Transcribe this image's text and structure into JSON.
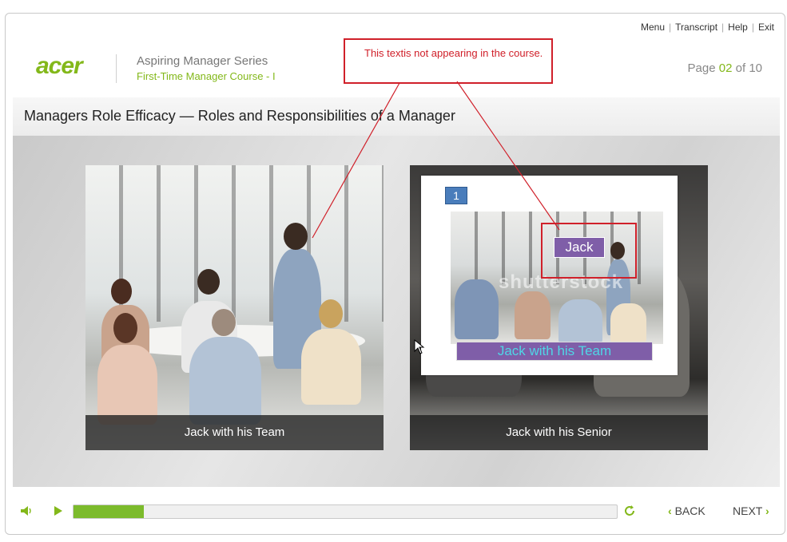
{
  "nav": {
    "menu": "Menu",
    "transcript": "Transcript",
    "help": "Help",
    "exit": "Exit",
    "sep": "|"
  },
  "brand": {
    "logo": "acer",
    "series": "Aspiring Manager Series",
    "course": "First-Time Manager Course - I",
    "accent_color": "#83b81a"
  },
  "page_indicator": {
    "prefix": "Page",
    "current": "02",
    "of": "of",
    "total": "10"
  },
  "title": "Managers Role Efficacy — Roles and Responsibilities of a Manager",
  "cards": [
    {
      "caption": "Jack with his Team"
    },
    {
      "caption": "Jack with his Senior"
    }
  ],
  "popup": {
    "badge": "1",
    "watermark": "shutterstock",
    "jack_label": "Jack",
    "team_label": "Jack with his Team"
  },
  "annotation": {
    "text": "This textis not appearing in the course.",
    "color": "#d0202a"
  },
  "controls": {
    "back": "BACK",
    "next": "NEXT",
    "progress_fraction": 0.13
  }
}
